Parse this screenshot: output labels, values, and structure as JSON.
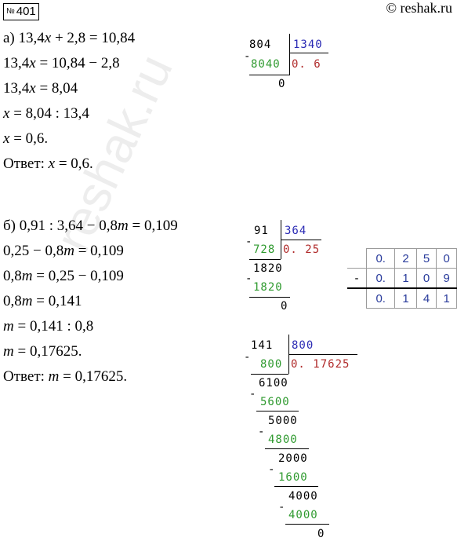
{
  "header": {
    "badge_symbol": "№",
    "badge_number": "401",
    "watermark": "© reshak.ru"
  },
  "background_watermark": "reshak.ru",
  "part_a": {
    "lines": [
      [
        "а) 13,4",
        "x",
        " + 2,8 = 10,84"
      ],
      [
        "13,4",
        "x",
        " = 10,84 − 2,8"
      ],
      [
        "13,4",
        "x",
        " = 8,04"
      ],
      [
        "",
        "x",
        " = 8,04 : 13,4"
      ],
      [
        "",
        "x",
        " = 0,6."
      ],
      [
        "Ответ: ",
        "x",
        " = 0,6."
      ]
    ]
  },
  "part_b": {
    "lines": [
      [
        "б) 0,91 : 3,64 − 0,8",
        "m",
        " = 0,109"
      ],
      [
        "0,25 − 0,8",
        "m",
        " = 0,109"
      ],
      [
        "0,8",
        "m",
        " = 0,25 − 0,109"
      ],
      [
        "0,8",
        "m",
        " = 0,141"
      ],
      [
        "",
        "m",
        " = 0,141 : 0,8"
      ],
      [
        "",
        "m",
        " = 0,17625."
      ],
      [
        "Ответ: ",
        "m",
        " = 0,17625."
      ]
    ]
  },
  "division_1": {
    "dividend": "804",
    "divisor": "1340",
    "minus": "-",
    "subtrahend": "8040",
    "quotient": "0. 6",
    "remainder": "0"
  },
  "division_2": {
    "dividend": "91",
    "divisor": "364",
    "minus": "-",
    "subtrahend": "728",
    "quotient": "0. 25",
    "step": "1820",
    "step_sub": "1820",
    "remainder": "0"
  },
  "division_3": {
    "dividend": "141",
    "divisor": "800",
    "minus": "-",
    "subtrahend": "800",
    "quotient": "0. 17625",
    "steps": [
      {
        "value": "6100",
        "sub": "5600"
      },
      {
        "value": "5000",
        "sub": "4800"
      },
      {
        "value": "2000",
        "sub": "1600"
      },
      {
        "value": "4000",
        "sub": "4000"
      }
    ],
    "remainder": "0"
  },
  "subtraction_table": {
    "sign": "-",
    "row1": [
      "0.",
      "2",
      "5",
      "0"
    ],
    "row2": [
      "0.",
      "1",
      "0",
      "9"
    ],
    "result": [
      "0.",
      "1",
      "4",
      "1"
    ]
  }
}
